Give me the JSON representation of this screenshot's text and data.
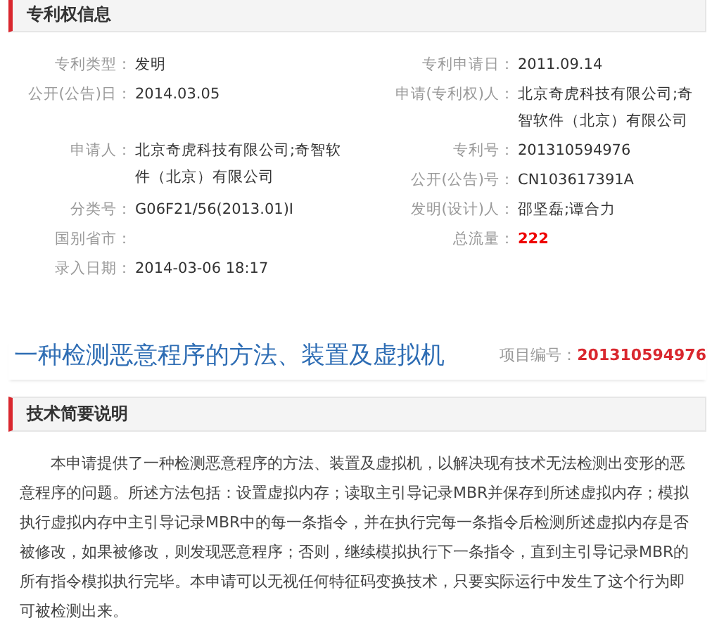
{
  "info_section": {
    "title": "专利权信息"
  },
  "rows": [
    {
      "left": [
        {
          "label": "专利类型：",
          "value": "发明",
          "highlight": false
        }
      ],
      "right": [
        {
          "label": "专利申请日：",
          "value": "2011.09.14",
          "highlight": false
        }
      ]
    },
    {
      "left": [
        {
          "label": "公开(公告)日：",
          "value": "2014.03.05",
          "highlight": false
        }
      ],
      "right": [
        {
          "label": "申请(专利权)人：",
          "value": "北京奇虎科技有限公司;奇智软件（北京）有限公司",
          "highlight": false
        }
      ]
    },
    {
      "left": [
        {
          "label": "申请人：",
          "value": "北京奇虎科技有限公司;奇智软件（北京）有限公司",
          "highlight": false
        }
      ],
      "right": [
        {
          "label": "专利号：",
          "value": "201310594976",
          "highlight": false
        },
        {
          "label": "公开(公告)号：",
          "value": "CN103617391A",
          "highlight": false
        }
      ]
    },
    {
      "left": [
        {
          "label": "分类号：",
          "value": "G06F21/56(2013.01)I",
          "highlight": false
        }
      ],
      "right": [
        {
          "label": "发明(设计)人：",
          "value": "邵坚磊;谭合力",
          "highlight": false
        }
      ]
    },
    {
      "left": [
        {
          "label": "国别省市："
        }
      ],
      "right": [
        {
          "label": "总流量：",
          "value": "222",
          "highlight": true
        }
      ]
    },
    {
      "left": [
        {
          "label": "录入日期：",
          "value": "2014-03-06 18:17",
          "highlight": false
        }
      ],
      "right": []
    }
  ],
  "patent": {
    "title": "一种检测恶意程序的方法、装置及虚拟机",
    "project_label": "项目编号：",
    "project_number": "201310594976"
  },
  "summary_section": {
    "title": "技术简要说明"
  },
  "summary": "本申请提供了一种检测恶意程序的方法、装置及虚拟机，以解决现有技术无法检测出变形的恶意程序的问题。所述方法包括：设置虚拟内存；读取主引导记录MBR并保存到所述虚拟内存；模拟执行虚拟内存中主引导记录MBR中的每一条指令，并在执行完每一条指令后检测所述虚拟内存是否被修改，如果被修改，则发现恶意程序；否则，继续模拟执行下一条指令，直到主引导记录MBR的所有指令模拟执行完毕。本申请可以无视任何特征码变换技术，只要实际运行中发生了这个行为即可被检测出来。"
}
